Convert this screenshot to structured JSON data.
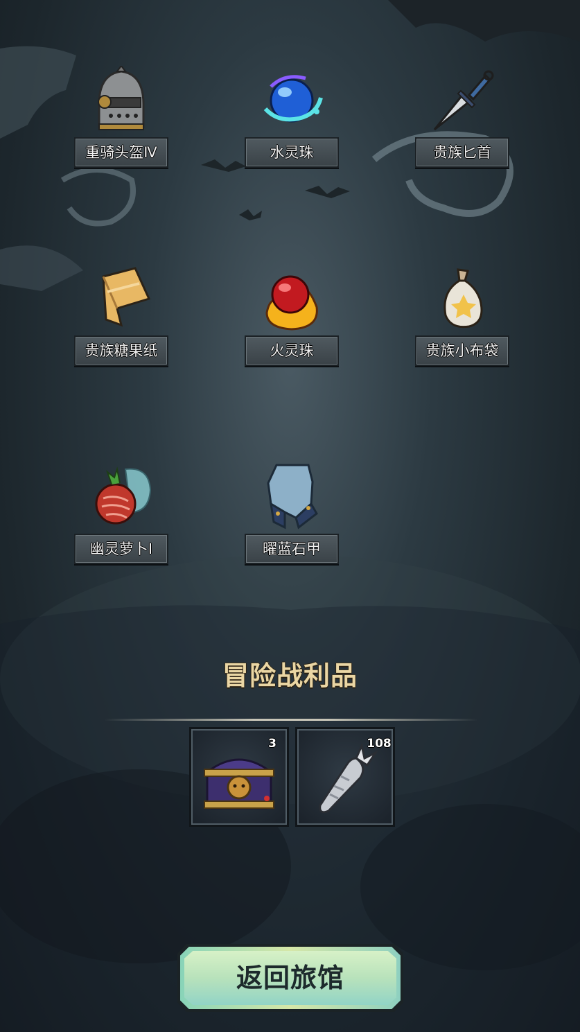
{
  "items": [
    {
      "name": "重骑头盔Ⅳ",
      "icon": "knight-helmet-icon"
    },
    {
      "name": "水灵珠",
      "icon": "water-orb-icon"
    },
    {
      "name": "贵族匕首",
      "icon": "noble-dagger-icon"
    },
    {
      "name": "贵族糖果纸",
      "icon": "candy-wrapper-icon"
    },
    {
      "name": "火灵珠",
      "icon": "fire-orb-icon"
    },
    {
      "name": "贵族小布袋",
      "icon": "cloth-pouch-icon"
    },
    {
      "name": "幽灵萝卜Ⅰ",
      "icon": "ghost-radish-icon"
    },
    {
      "name": "曜蓝石甲",
      "icon": "blue-stone-armor-icon"
    }
  ],
  "loot": {
    "title": "冒险战利品",
    "rewards": [
      {
        "icon": "treasure-chest-icon",
        "count": "3"
      },
      {
        "icon": "silver-carrot-icon",
        "count": "108"
      }
    ]
  },
  "return_button": {
    "label": "返回旅馆"
  },
  "colors": {
    "title": "#ead6a4",
    "badge": "#2a7fd0",
    "button": "#b8e2bb"
  }
}
